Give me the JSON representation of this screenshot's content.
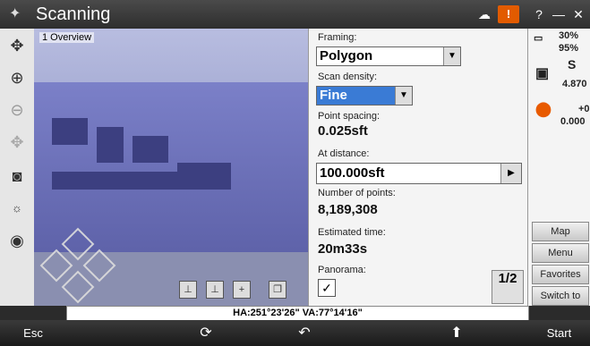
{
  "window": {
    "title": "Scanning",
    "alert": "!"
  },
  "window_controls": {
    "help": "?",
    "minimize": "—",
    "close": "✕"
  },
  "viewport": {
    "overview_label": "1 Overview"
  },
  "settings": {
    "framing_label": "Framing:",
    "framing_value": "Polygon",
    "density_label": "Scan density:",
    "density_value": "Fine",
    "spacing_label": "Point spacing:",
    "spacing_value": "0.025sft",
    "distance_label": "At distance:",
    "distance_value": "100.000sft",
    "points_label": "Number of points:",
    "points_value": "8,189,308",
    "time_label": "Estimated time:",
    "time_value": "20m33s",
    "panorama_label": "Panorama:",
    "panorama_checked": "✓",
    "pager": "1/2"
  },
  "right_status": {
    "battery1": "30%",
    "battery2": "95%",
    "sat": "S",
    "height": "4.870",
    "offset": "+0",
    "offset2": "0.000"
  },
  "side_buttons": [
    "Map",
    "Menu",
    "Favorites",
    "Switch to"
  ],
  "status_bar": {
    "text": "HA:251°23'26\"  VA:77°14'16\""
  },
  "bottom": {
    "esc": "Esc",
    "start": "Start"
  }
}
